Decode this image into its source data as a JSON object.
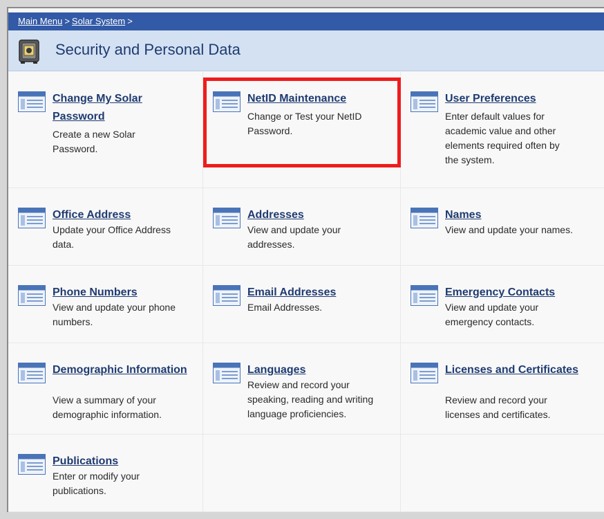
{
  "breadcrumb": {
    "main_menu": "Main Menu",
    "sep1": ">",
    "solar_system": "Solar System",
    "sep2": ">"
  },
  "page": {
    "title": "Security and Personal Data",
    "icon": "safe-icon"
  },
  "colors": {
    "breadcrumb_bg": "#335aa6",
    "title_bg": "#d3e1f2",
    "link": "#1f3b71",
    "highlight": "#ee1c1c"
  },
  "items": [
    {
      "id": "change-password",
      "title_line1": "Change My Solar",
      "title_line2": "Password",
      "desc": [
        "Create a new Solar",
        "Password."
      ],
      "icon": "form-icon"
    },
    {
      "id": "netid-maintenance",
      "title": "NetID Maintenance",
      "desc": [
        "Change or Test your NetID",
        "Password."
      ],
      "icon": "form-icon",
      "highlighted": true
    },
    {
      "id": "user-preferences",
      "title": "User Preferences",
      "desc": [
        "Enter default values for",
        "academic value and other",
        "elements required often by",
        "the system."
      ],
      "icon": "form-icon"
    },
    {
      "id": "office-address",
      "title": "Office Address",
      "desc": [
        "Update your Office Address",
        "data."
      ],
      "icon": "form-icon"
    },
    {
      "id": "addresses",
      "title": "Addresses",
      "desc": [
        "View and update your",
        "addresses."
      ],
      "icon": "form-icon"
    },
    {
      "id": "names",
      "title": "Names",
      "desc": [
        "View and update your names."
      ],
      "icon": "form-icon"
    },
    {
      "id": "phone-numbers",
      "title": "Phone Numbers",
      "desc": [
        "View and update your phone",
        "numbers."
      ],
      "icon": "form-icon"
    },
    {
      "id": "email-addresses",
      "title": "Email Addresses",
      "desc": [
        "Email Addresses."
      ],
      "icon": "form-icon"
    },
    {
      "id": "emergency-contacts",
      "title": "Emergency Contacts",
      "desc": [
        "View and update your",
        "emergency contacts."
      ],
      "icon": "form-icon"
    },
    {
      "id": "demographic-information",
      "title": "Demographic Information",
      "desc": [
        "View a summary of your",
        "demographic information."
      ],
      "icon": "form-icon"
    },
    {
      "id": "languages",
      "title": "Languages",
      "desc": [
        "Review and record your",
        "speaking, reading and writing",
        "language proficiencies."
      ],
      "icon": "form-icon"
    },
    {
      "id": "licenses-certificates",
      "title": "Licenses and Certificates",
      "desc": [
        "Review and record your",
        "licenses and certificates."
      ],
      "icon": "form-icon"
    },
    {
      "id": "publications",
      "title": "Publications",
      "desc": [
        "Enter or modify your",
        "publications."
      ],
      "icon": "form-icon"
    }
  ]
}
